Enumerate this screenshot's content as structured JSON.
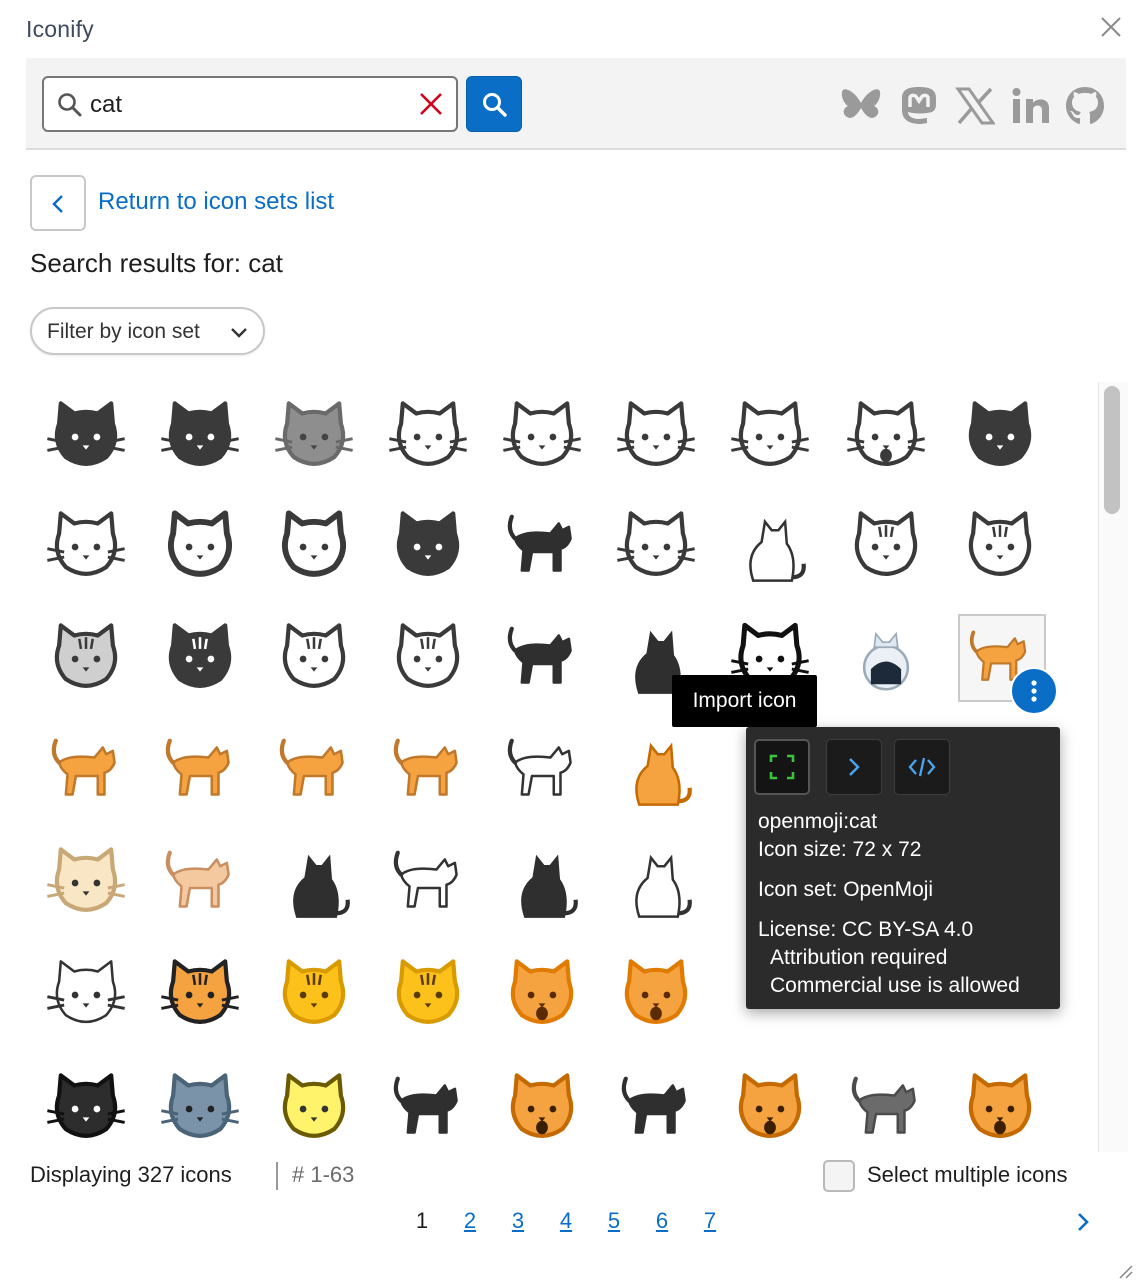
{
  "app": {
    "title": "Iconify"
  },
  "search": {
    "value": "cat"
  },
  "social": [
    "bluesky-icon",
    "mastodon-icon",
    "x-icon",
    "linkedin-icon",
    "github-icon"
  ],
  "nav": {
    "back_label": "Return to icon sets list"
  },
  "results": {
    "title": "Search results for: cat",
    "filter_label": "Filter by icon set"
  },
  "grid": {
    "rows": [
      [
        "cat-face-solid",
        "cat-face-solid",
        "cat-face-gray",
        "cat-face-outline",
        "cat-face-outline",
        "cat-face-outline",
        "cat-face-outline",
        "cat-face-open-mouth",
        "cat-face-solid-plain"
      ],
      [
        "cat-face-outline",
        "cat-face-round-outline",
        "cat-face-round-outline",
        "cat-face-round-solid",
        "cat-standing-solid",
        "cat-face-outline",
        "cat-sitting-line",
        "cat-face-outline-tabby",
        "cat-face-outline-tabby"
      ],
      [
        "cat-face-gray-tabby",
        "cat-face-solid-tabby",
        "cat-face-outline-tabby",
        "cat-face-outline-tabby",
        "cat-walking-silhouette",
        "cat-sitting-silhouette",
        "cat-face-black",
        "astronaut-cat",
        "cat-walking-orange"
      ],
      [
        "cat-walking-orange",
        "cat-walking-orange",
        "cat-walking-orange",
        "cat-walking-orange",
        "cat-outline-arched",
        "cat-sitting-orange",
        "",
        "",
        ""
      ],
      [
        "cat-face-cream",
        "cat-walking-cream",
        "cat-lying-black",
        "cat-outline-thin",
        "cat-sitting-silhouette",
        "cat-sitting-line",
        "",
        "",
        ""
      ],
      [
        "cat-drawing",
        "cat-face-orange",
        "cat-face-yellow",
        "cat-face-yellow",
        "cat-face-smiling",
        "cat-face-smiling",
        "",
        "",
        ""
      ],
      [
        "cat-face-tuxedo",
        "cat-face-blue",
        "cat-face-yellow-outline",
        "cat-walking-black",
        "cat-face-scream",
        "cat-walking-black",
        "cat-face-scream",
        "cat-walking-gray",
        "cat-face-scream"
      ]
    ],
    "selected_icon": "openmoji:cat"
  },
  "tooltip": {
    "text": "Import icon"
  },
  "popover": {
    "actions": [
      "fullscreen-icon",
      "chevron-right-icon",
      "code-icon"
    ],
    "name": "openmoji:cat",
    "size": "Icon size: 72 x 72",
    "set": "Icon set: OpenMoji",
    "license": "License: CC BY-SA 4.0",
    "attribution": "Attribution required",
    "commercial": "Commercial use is allowed"
  },
  "footer": {
    "count": "Displaying 327 icons",
    "range": "# 1-63",
    "multi_label": "Select multiple icons",
    "pages": [
      "1",
      "2",
      "3",
      "4",
      "5",
      "6",
      "7"
    ],
    "current_page": "1"
  },
  "colors": {
    "accent": "#0a6dc6",
    "dark_icon": "#3a3a3a",
    "orange": "#f4a340",
    "yellow": "#fcc21b",
    "clear": "#d0021b"
  }
}
